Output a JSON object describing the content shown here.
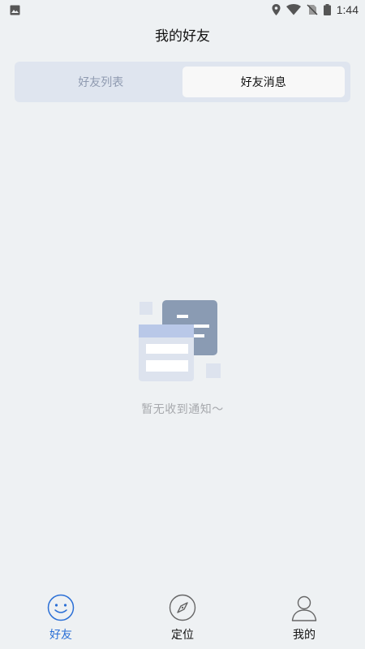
{
  "status_bar": {
    "time": "1:44",
    "icons": [
      "image-icon",
      "location-icon",
      "wifi-icon",
      "no-sim-icon",
      "battery-icon"
    ]
  },
  "header": {
    "title": "我的好友"
  },
  "tabs": [
    {
      "label": "好友列表",
      "active": false
    },
    {
      "label": "好友消息",
      "active": true
    }
  ],
  "empty_state": {
    "icon": "empty-message-illustration",
    "message": "暂无收到通知～"
  },
  "bottom_nav": {
    "items": [
      {
        "label": "好友",
        "icon": "smile-icon",
        "active": true
      },
      {
        "label": "定位",
        "icon": "compass-icon",
        "active": false
      },
      {
        "label": "我的",
        "icon": "person-icon",
        "active": false
      }
    ]
  },
  "colors": {
    "background": "#eef1f3",
    "segment_bg": "#dfe5ef",
    "accent": "#2a6fd6",
    "inactive_text": "#8f9ab0",
    "empty_text": "#a7a9ad"
  }
}
